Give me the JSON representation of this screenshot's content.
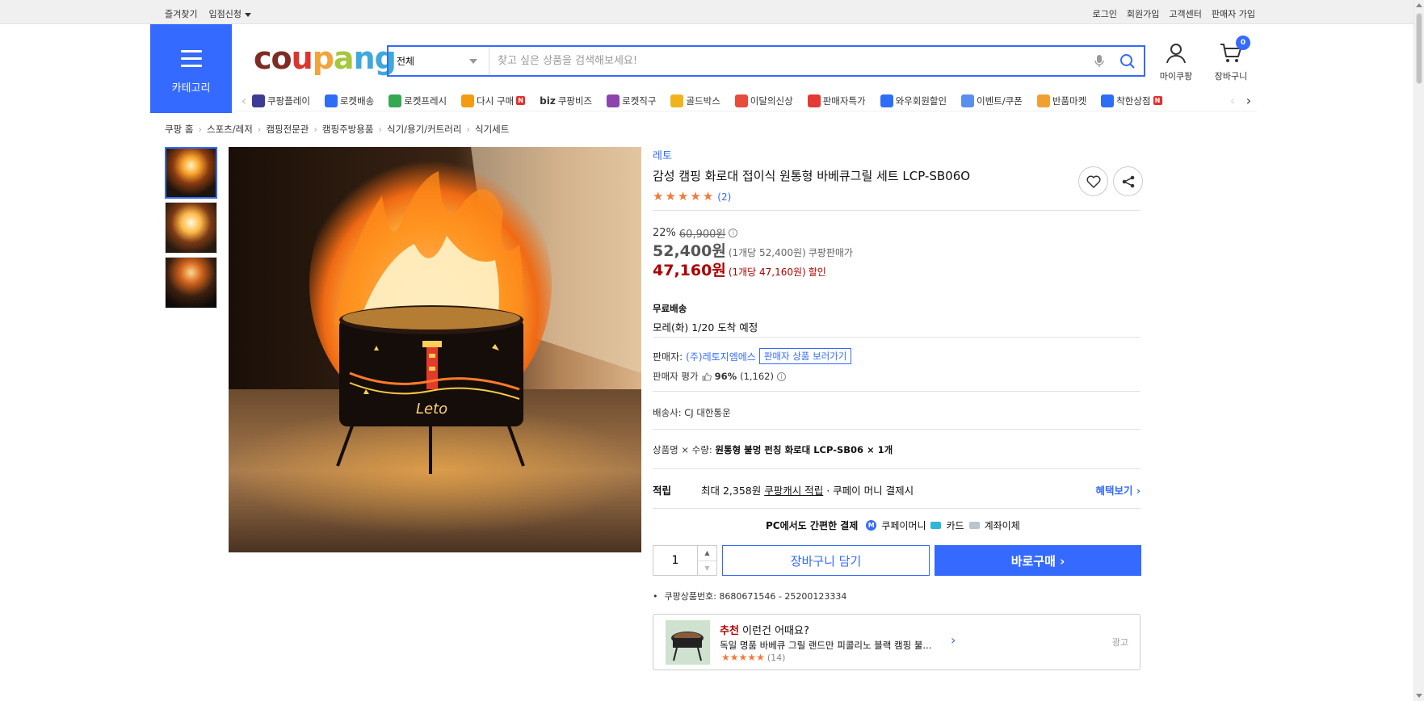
{
  "topbar": {
    "left": [
      "즐겨찾기",
      "입점신청"
    ],
    "right": [
      "로그인",
      "회원가입",
      "고객센터",
      "판매자 가입"
    ]
  },
  "header": {
    "category_label": "카테고리",
    "logo_text": "coupang",
    "search": {
      "category": "전체",
      "placeholder": "찾고 싶은 상품을 검색해보세요!"
    },
    "mycoupang_label": "마이쿠팡",
    "cart_label": "장바구니",
    "cart_count": "0"
  },
  "nav": {
    "items": [
      {
        "label": "쿠팡플레이",
        "icon": "play-icon",
        "color": "#3c3c96"
      },
      {
        "label": "로켓배송",
        "icon": "rocket-icon",
        "color": "#2e6ef7"
      },
      {
        "label": "로켓프레시",
        "icon": "rocket-fresh-icon",
        "color": "#34a853"
      },
      {
        "label": "다시 구매",
        "icon": "rebuy-icon",
        "color": "#f39c12",
        "badge": "N"
      },
      {
        "label": "쿠팡비즈",
        "prefix": "biz",
        "icon": "biz-icon",
        "color": "#333"
      },
      {
        "label": "로켓직구",
        "icon": "global-icon",
        "color": "#8e44ad"
      },
      {
        "label": "골드박스",
        "icon": "goldbox-icon",
        "color": "#f1b31c"
      },
      {
        "label": "이달의신상",
        "icon": "new-icon",
        "color": "#e74c3c"
      },
      {
        "label": "판매자특가",
        "icon": "percent-icon",
        "color": "#e53935"
      },
      {
        "label": "와우회원할인",
        "icon": "wow-icon",
        "color": "#2e6ef7"
      },
      {
        "label": "이벤트/쿠폰",
        "icon": "coupon-icon",
        "color": "#5b8def"
      },
      {
        "label": "반품마켓",
        "icon": "return-icon",
        "color": "#f0a030"
      },
      {
        "label": "착한상점",
        "icon": "shop-icon",
        "color": "#2e6ef7",
        "badge": "N"
      }
    ]
  },
  "breadcrumb": [
    "쿠팡 홈",
    "스포츠/레저",
    "캠핑전문관",
    "캠핑주방용품",
    "식기/용기/커트러리",
    "식기세트"
  ],
  "product": {
    "brand": "레토",
    "title": "감성 캠핑 화로대 접이식 원통형 바베큐그릴 세트 LCP-SB06O",
    "rating_stars": 5,
    "review_count": "(2)",
    "discount_rate": "22%",
    "original_price": "60,900원",
    "price": "52,400원",
    "unit_price": "(1개당 52,400원)",
    "price_tag": "쿠팡판매가",
    "coupon_price": "47,160원",
    "coupon_unit": "(1개당 47,160원)",
    "coupon_tag": "할인",
    "shipping_title": "무료배송",
    "arrival": "모레(화) 1/20 도착 예정",
    "seller_label": "판매자:",
    "seller_name": "(주)레토지엠에스",
    "seller_link": "판매자 상품 보러가기",
    "seller_rating_label": "판매자 평가",
    "seller_rating_pct": "96%",
    "seller_rating_count": "(1,162)",
    "carrier": "배송사:  CJ 대한통운",
    "option_label": "상품명 × 수량:",
    "option_value": "원통형 불멍 펀칭 화로대 LCP-SB06 × 1개",
    "reward_label": "적립",
    "reward_text1": "최대 2,358원 ",
    "reward_text2": "쿠팡캐시 적립",
    "reward_text3": " · 쿠페이 머니 결제시",
    "reward_more": "혜택보기",
    "pay_title": "PC에서도 간편한 결제",
    "pay_methods": [
      "쿠페이머니",
      "카드",
      "계좌이체"
    ],
    "quantity": "1",
    "cart_button": "장바구니 담기",
    "buy_button": "바로구매",
    "product_number": "쿠팡상품번호: 8680671546 - 25200123334"
  },
  "recommend": {
    "head_red": "추천",
    "head": " 이런건 어때요?",
    "desc": "독일 명품 바베큐 그릴 랜드만 피콜리노 블랙 캠핑 불...",
    "count": "(14)",
    "ad": "광고"
  },
  "colors": {
    "accent": "#346aff",
    "price_red": "#ae0000",
    "star": "#f47a3a"
  }
}
